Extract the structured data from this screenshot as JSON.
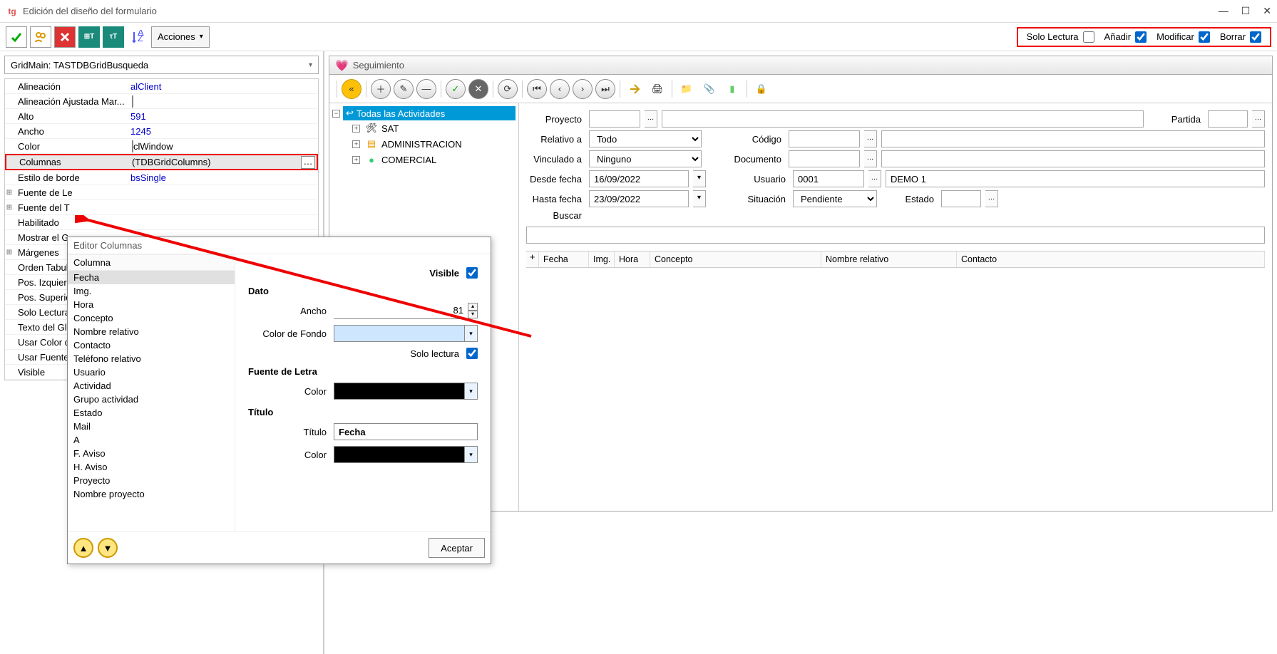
{
  "window": {
    "title": "Edición del diseño del formulario",
    "logo": "tg"
  },
  "toolbar": {
    "acciones": "Acciones",
    "perms": {
      "solo_lectura": "Solo Lectura",
      "anadir": "Añadir",
      "modificar": "Modificar",
      "borrar": "Borrar"
    }
  },
  "object_selector": "GridMain: TASTDBGridBusqueda",
  "props": [
    {
      "label": "Alineación",
      "value": "alClient",
      "blue": true
    },
    {
      "label": "Alineación Ajustada Mar...",
      "value": "",
      "chk": true
    },
    {
      "label": "Alto",
      "value": "591",
      "blue": true
    },
    {
      "label": "Ancho",
      "value": "1245",
      "blue": true
    },
    {
      "label": "Color",
      "value": "clWindow",
      "chk": true
    },
    {
      "label": "Columnas",
      "value": "(TDBGridColumns)",
      "hl": true,
      "ellipsis": true
    },
    {
      "label": "Estilo de borde",
      "value": "bsSingle",
      "blue": true
    },
    {
      "label": "Fuente de Le",
      "exp": true
    },
    {
      "label": "Fuente del T",
      "exp": true
    },
    {
      "label": "Habilitado"
    },
    {
      "label": "Mostrar el G"
    },
    {
      "label": "Márgenes",
      "exp": true
    },
    {
      "label": "Orden Tabula"
    },
    {
      "label": "Pos. Izquierd"
    },
    {
      "label": "Pos. Superio"
    },
    {
      "label": "Solo Lectura"
    },
    {
      "label": "Texto del Glo"
    },
    {
      "label": "Usar Color d"
    },
    {
      "label": "Usar Fuente"
    },
    {
      "label": "Visible"
    }
  ],
  "coleditor": {
    "title": "Editor Columnas",
    "header": "Columna",
    "items": [
      "Fecha",
      "Img.",
      "Hora",
      "Concepto",
      "Nombre relativo",
      "Contacto",
      "Teléfono relativo",
      "Usuario",
      "Actividad",
      "Grupo actividad",
      "Estado",
      "Mail",
      "A",
      "F. Aviso",
      "H. Aviso",
      "Proyecto",
      "Nombre proyecto"
    ],
    "selected": "Fecha",
    "form": {
      "visible_label": "Visible",
      "dato": "Dato",
      "ancho_label": "Ancho",
      "ancho_value": "81",
      "color_fondo_label": "Color de Fondo",
      "solo_lectura_label": "Solo lectura",
      "fuente": "Fuente de Letra",
      "color_label": "Color",
      "color_value": "#000000",
      "titulo_section": "Título",
      "titulo_label": "Título",
      "titulo_value": "Fecha",
      "titulo_color": "#000000"
    },
    "accept": "Aceptar"
  },
  "preview": {
    "title": "Seguimiento",
    "tree": {
      "root": "Todas las Actividades",
      "items": [
        "SAT",
        "ADMINISTRACION",
        "COMERCIAL"
      ]
    },
    "filters": {
      "proyecto": "Proyecto",
      "partida": "Partida",
      "relativo_a": "Relativo a",
      "relativo_a_val": "Todo",
      "codigo": "Código",
      "vinculado_a": "Vinculado a",
      "vinculado_a_val": "Ninguno",
      "documento": "Documento",
      "desde": "Desde fecha",
      "desde_val": "16/09/2022",
      "usuario": "Usuario",
      "usuario_val": "0001",
      "usuario_name": "DEMO 1",
      "hasta": "Hasta fecha",
      "hasta_val": "23/09/2022",
      "situacion": "Situación",
      "situacion_val": "Pendiente",
      "estado": "Estado",
      "buscar": "Buscar"
    },
    "grid_columns": [
      "Fecha",
      "Img.",
      "Hora",
      "Concepto",
      "Nombre relativo",
      "Contacto"
    ]
  }
}
